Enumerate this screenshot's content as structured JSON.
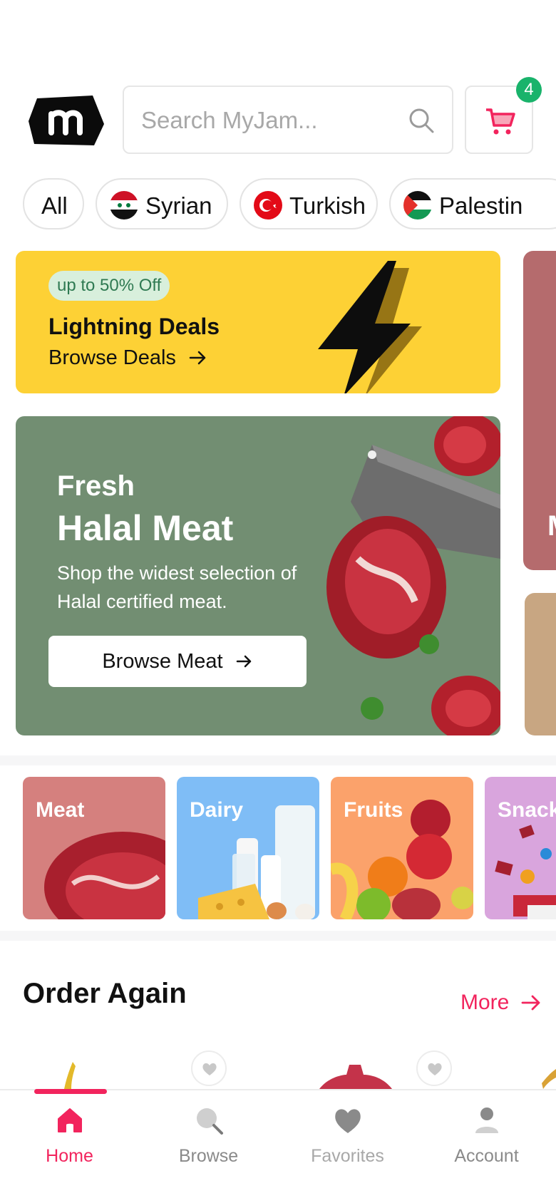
{
  "colors": {
    "accent": "#f2245d",
    "badge_green": "#19b36b",
    "deals_yellow": "#fdd135",
    "hero_green": "#728e72"
  },
  "header": {
    "logo_icon": "myjam-logo-m",
    "search": {
      "placeholder": "Search MyJam...",
      "icon": "search-icon"
    },
    "cart": {
      "icon": "cart-icon",
      "count": "4"
    }
  },
  "filters": [
    {
      "label": "All"
    },
    {
      "label": "Syrian",
      "flag": "syria-flag-icon"
    },
    {
      "label": "Turkish",
      "flag": "turkey-flag-icon"
    },
    {
      "label": "Palestin",
      "flag": "palestine-flag-icon"
    }
  ],
  "deals": {
    "badge": "up to 50% Off",
    "title": "Lightning Deals",
    "link": "Browse Deals",
    "icon": "lightning-bolt-icon"
  },
  "hero": {
    "kicker": "Fresh",
    "title": "Halal Meat",
    "description": "Shop the widest selection of Halal certified meat.",
    "button": "Browse Meat"
  },
  "side_peek": {
    "letter": "M"
  },
  "categories": [
    {
      "label": "Meat",
      "color": "#d5807e"
    },
    {
      "label": "Dairy",
      "color": "#7fbdf6"
    },
    {
      "label": "Fruits",
      "color": "#fba26b"
    },
    {
      "label": "Snack",
      "color": "#d9a5dd"
    }
  ],
  "order_again": {
    "title": "Order Again",
    "more": "More"
  },
  "bottom_nav": [
    {
      "label": "Home",
      "icon": "home-icon",
      "active": true
    },
    {
      "label": "Browse",
      "icon": "search-icon",
      "active": false
    },
    {
      "label": "Favorites",
      "icon": "heart-icon",
      "active": false
    },
    {
      "label": "Account",
      "icon": "person-icon",
      "active": false
    }
  ]
}
